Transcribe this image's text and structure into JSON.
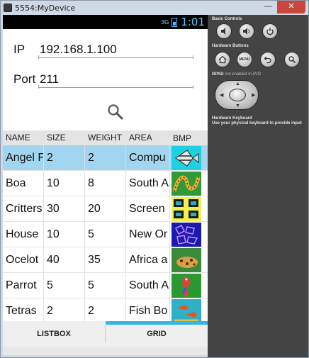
{
  "window": {
    "title": "5554:MyDevice"
  },
  "status_bar": {
    "signal": "3G",
    "time": "1:01"
  },
  "form": {
    "ip_label": "IP",
    "ip_value": "192.168.1.100",
    "port_label": "Port",
    "port_value": "211"
  },
  "grid": {
    "headers": [
      "NAME",
      "SIZE",
      "WEIGHT",
      "AREA",
      "BMP"
    ],
    "rows": [
      {
        "name": "Angel F",
        "size": "2",
        "weight": "2",
        "area": "Compu",
        "selected": true
      },
      {
        "name": "Boa",
        "size": "10",
        "weight": "8",
        "area": "South A",
        "selected": false
      },
      {
        "name": "Critters",
        "size": "30",
        "weight": "20",
        "area": "Screen",
        "selected": false
      },
      {
        "name": "House",
        "size": "10",
        "weight": "5",
        "area": "New Or",
        "selected": false
      },
      {
        "name": "Ocelot",
        "size": "40",
        "weight": "35",
        "area": "Africa a",
        "selected": false
      },
      {
        "name": "Parrot",
        "size": "5",
        "weight": "5",
        "area": "South A",
        "selected": false
      },
      {
        "name": "Tetras",
        "size": "2",
        "weight": "2",
        "area": "Fish Bo",
        "selected": false
      }
    ]
  },
  "tabs": [
    {
      "label": "LISTBOX",
      "active": false
    },
    {
      "label": "GRID",
      "active": true
    }
  ],
  "panel": {
    "basic_controls": "Basic Controls",
    "hardware_buttons": "Hardware Buttons",
    "menu_label": "MENU",
    "dpad_note_bold": "DPAD",
    "dpad_note": "not enabled in AVD",
    "keyboard_title": "Hardware Keyboard",
    "keyboard_note": "Use your physical keyboard to provide input"
  },
  "colors": {
    "selection": "#a1d5f0",
    "accent": "#33b5e5",
    "panel_bg": "#444444",
    "status_bar_bg": "#000000"
  },
  "icons": {
    "search": "magnifier-icon",
    "volume_down": "volume-down-icon",
    "volume_up": "volume-up-icon",
    "power": "power-icon",
    "home": "home-icon",
    "back": "back-icon",
    "hw_search": "search-icon"
  }
}
